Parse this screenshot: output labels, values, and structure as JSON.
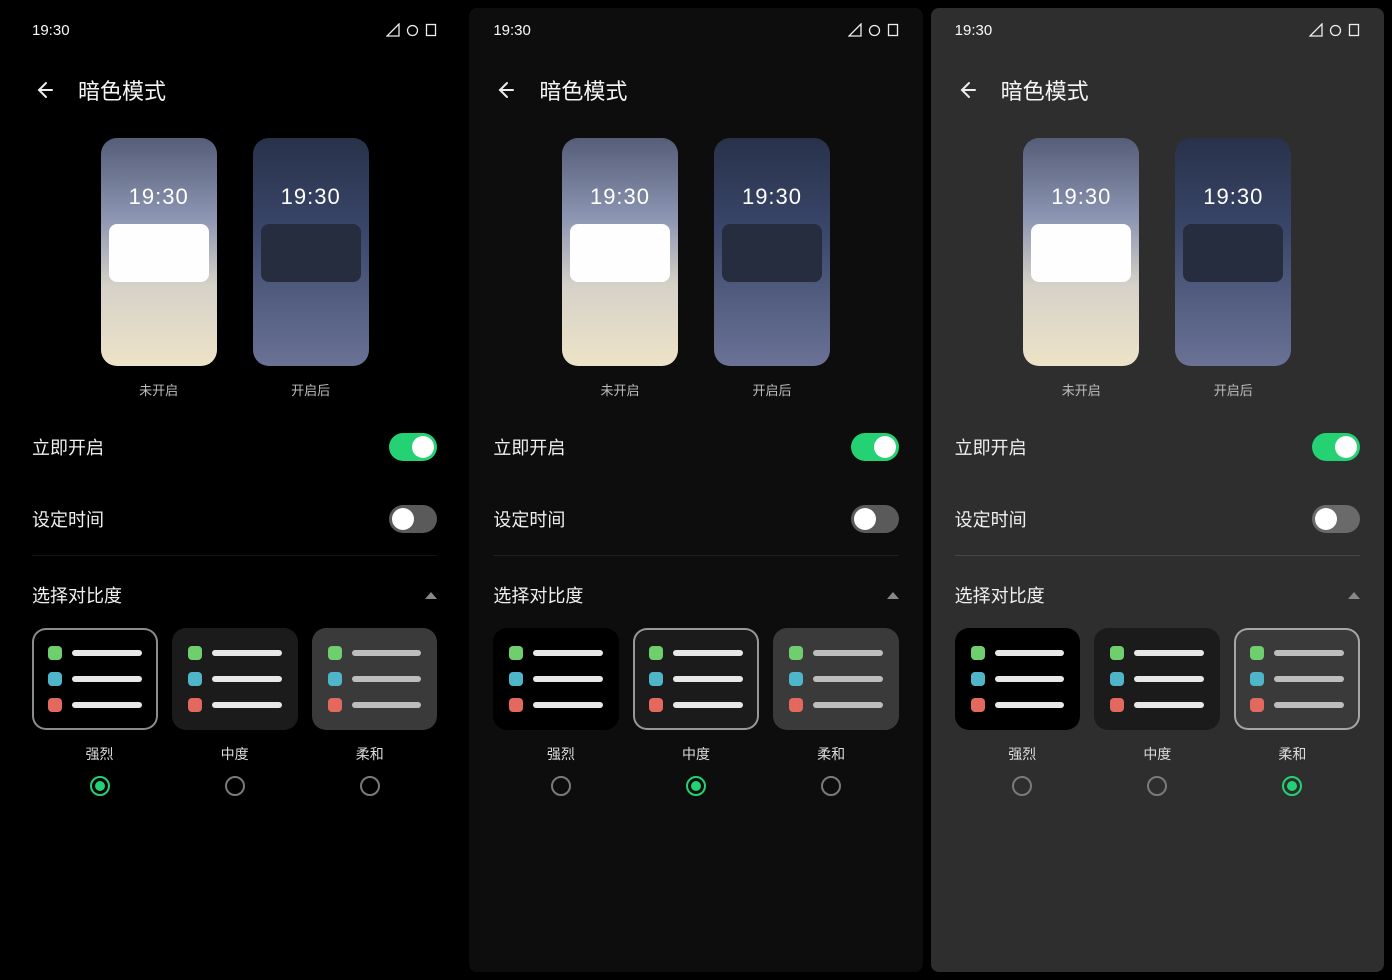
{
  "statusbar_time": "19:30",
  "page_title": "暗色模式",
  "preview": {
    "time": "19:30",
    "label_off": "未开启",
    "label_on": "开启后"
  },
  "rows": {
    "enable_now": "立即开启",
    "schedule": "设定时间"
  },
  "contrast_section": "选择对比度",
  "contrast_options": {
    "strong": "强烈",
    "medium": "中度",
    "soft": "柔和"
  },
  "screens": [
    {
      "bg": "strong",
      "enable_on": true,
      "schedule_on": false,
      "selected_contrast": "strong"
    },
    {
      "bg": "medium",
      "enable_on": true,
      "schedule_on": false,
      "selected_contrast": "medium"
    },
    {
      "bg": "soft",
      "enable_on": true,
      "schedule_on": false,
      "selected_contrast": "soft"
    }
  ],
  "colors": {
    "accent": "#24d173"
  }
}
